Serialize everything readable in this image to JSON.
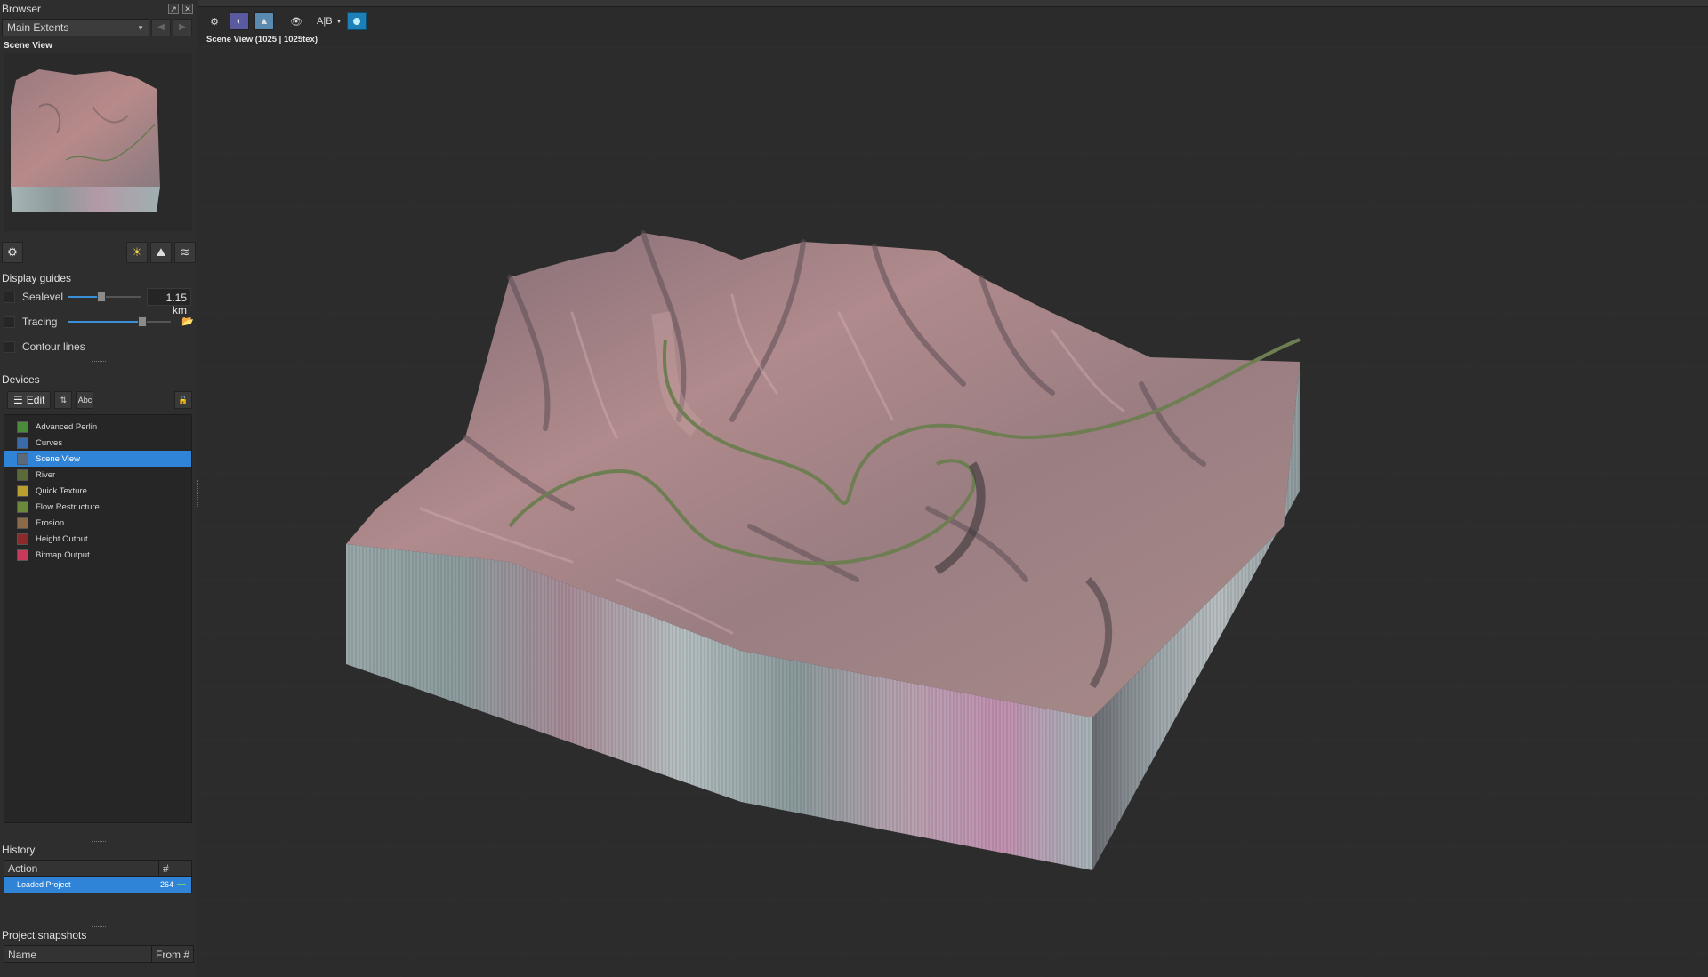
{
  "browser": {
    "title": "Browser",
    "combo_value": "Main Extents",
    "scene_label": "Scene View"
  },
  "display_guides": {
    "title": "Display guides",
    "sealevel_label": "Sealevel",
    "sealevel_value": "1.15 km",
    "sealevel_fraction": 0.45,
    "tracing_label": "Tracing",
    "tracing_fraction": 0.72,
    "contour_label": "Contour lines"
  },
  "devices": {
    "title": "Devices",
    "edit_label": "Edit",
    "abc_label": "Abc",
    "items": [
      {
        "label": "Advanced Perlin",
        "color": "#4a8a3a"
      },
      {
        "label": "Curves",
        "color": "#3a6aa8"
      },
      {
        "label": "Scene View",
        "color": "#5a6a7a"
      },
      {
        "label": "River",
        "color": "#5a6a3a"
      },
      {
        "label": "Quick Texture",
        "color": "#b8a030"
      },
      {
        "label": "Flow Restructure",
        "color": "#6a8a3a"
      },
      {
        "label": "Erosion",
        "color": "#8a6a4a"
      },
      {
        "label": "Height Output",
        "color": "#8a2a2a"
      },
      {
        "label": "Bitmap Output",
        "color": "#c83a5a"
      }
    ],
    "selected_index": 2
  },
  "history": {
    "title": "History",
    "col_action": "Action",
    "col_num": "#",
    "rows": [
      {
        "action": "Loaded Project",
        "num": "264"
      }
    ]
  },
  "snapshots": {
    "title": "Project snapshots",
    "col_name": "Name",
    "col_from": "From #"
  },
  "viewport": {
    "title": "Scene View (1025 | 1025tex)",
    "ab_label": "A|B"
  }
}
